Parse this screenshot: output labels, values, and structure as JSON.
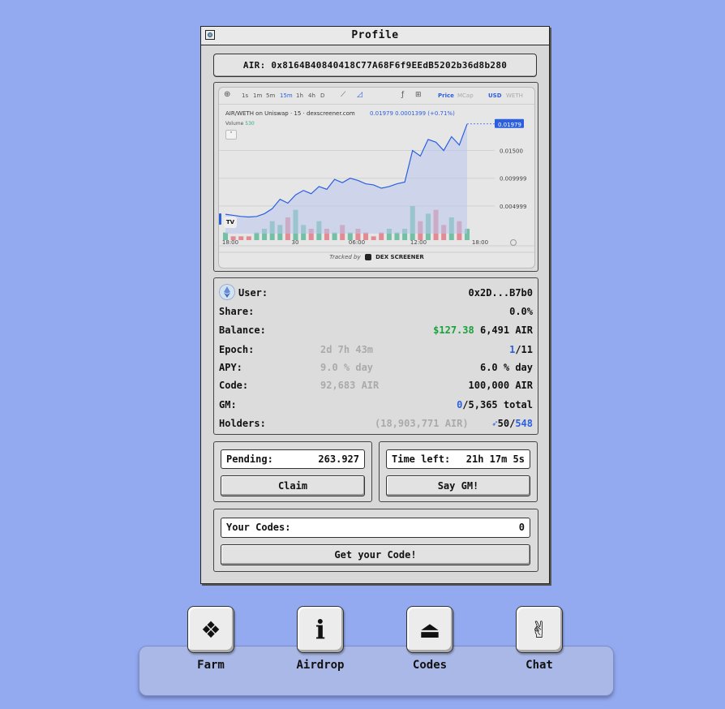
{
  "window": {
    "title": "Profile"
  },
  "address": "AIR: 0x8164B40840418C77A68F6f9EEdB5202b36d8b280",
  "chart": {
    "timeframes": [
      "1s",
      "1m",
      "5m",
      "15m",
      "1h",
      "4h",
      "D"
    ],
    "active_timeframe": "15m",
    "price_label": "Price",
    "mcap_label": "MCap",
    "pair_toggle_usd": "USD",
    "pair_toggle_weth": "WETH",
    "legend": "AIR/WETH on Uniswap · 15 · dexscreener.com",
    "legend_values": "0.01979  0.0001399 (+0.71%)",
    "volume_label": "Volume",
    "volume_value": "530",
    "current_price": "0.01979",
    "y_ticks": [
      "0.01500",
      "0.009999",
      "0.004999"
    ],
    "x_ticks": [
      "18:00",
      "30",
      "06:00",
      "12:00",
      "18:00"
    ],
    "tracked_by": "Tracked by",
    "brand": "DEX SCREENER",
    "colors": {
      "line": "#2b5fe0",
      "up": "#5fb89a",
      "down": "#e07a86",
      "badge": "#2b5fe0"
    }
  },
  "chart_data": {
    "type": "line",
    "title": "AIR/WETH on Uniswap · 15 · dexscreener.com",
    "x_ticks": [
      "18:00",
      "30",
      "06:00",
      "12:00",
      "18:00"
    ],
    "ylim": [
      0,
      0.0205
    ],
    "series": [
      {
        "values": [
          0.0035,
          0.0033,
          0.0031,
          0.003,
          0.0031,
          0.0036,
          0.0045,
          0.0062,
          0.0055,
          0.007,
          0.0078,
          0.0072,
          0.0085,
          0.008,
          0.0098,
          0.0092,
          0.01,
          0.0096,
          0.009,
          0.0088,
          0.0082,
          0.0085,
          0.009,
          0.0093,
          0.015,
          0.014,
          0.017,
          0.0165,
          0.015,
          0.0175,
          0.016,
          0.0198
        ]
      }
    ],
    "volume": [
      2,
      1,
      1,
      1,
      2,
      3,
      5,
      4,
      6,
      8,
      4,
      3,
      5,
      3,
      2,
      4,
      2,
      3,
      2,
      1,
      2,
      3,
      2,
      3,
      9,
      5,
      7,
      8,
      4,
      6,
      5,
      3
    ]
  },
  "info": {
    "user_label": "User:",
    "user_value": "0x2D...B7b0",
    "share_label": "Share:",
    "share_value": "0.0%",
    "balance_label": "Balance:",
    "balance_usd": "$127.38",
    "balance_air": "6,491 AIR",
    "epoch_label": "Epoch:",
    "epoch_mid": "2d 7h 43m",
    "epoch_current": "1",
    "epoch_total": "/11",
    "apy_label": "APY:",
    "apy_mid": "9.0 % day",
    "apy_value": "6.0 % day",
    "code_label": "Code:",
    "code_mid": "92,683 AIR",
    "code_value": "100,000 AIR",
    "gm_label": "GM:",
    "gm_current": "0",
    "gm_total": "/5,365 total",
    "holders_label": "Holders:",
    "holders_mid": "(18,903,771 AIR)",
    "holders_a": "50",
    "holders_sep": "/",
    "holders_b": "548"
  },
  "pending": {
    "label": "Pending:",
    "value": "263.927",
    "button": "Claim"
  },
  "timeleft": {
    "label": "Time left:",
    "value": "21h 17m 5s",
    "button": "Say GM!"
  },
  "codes": {
    "label": "Your Codes:",
    "value": "0",
    "button": "Get your Code!"
  },
  "dock": [
    {
      "label": "Farm",
      "icon": "diamond-grid-icon",
      "glyph": "❖"
    },
    {
      "label": "Airdrop",
      "icon": "info-icon",
      "glyph": "i"
    },
    {
      "label": "Codes",
      "icon": "eject-icon",
      "glyph": "⏏"
    },
    {
      "label": "Chat",
      "icon": "peace-hand-icon",
      "glyph": "✌"
    }
  ]
}
